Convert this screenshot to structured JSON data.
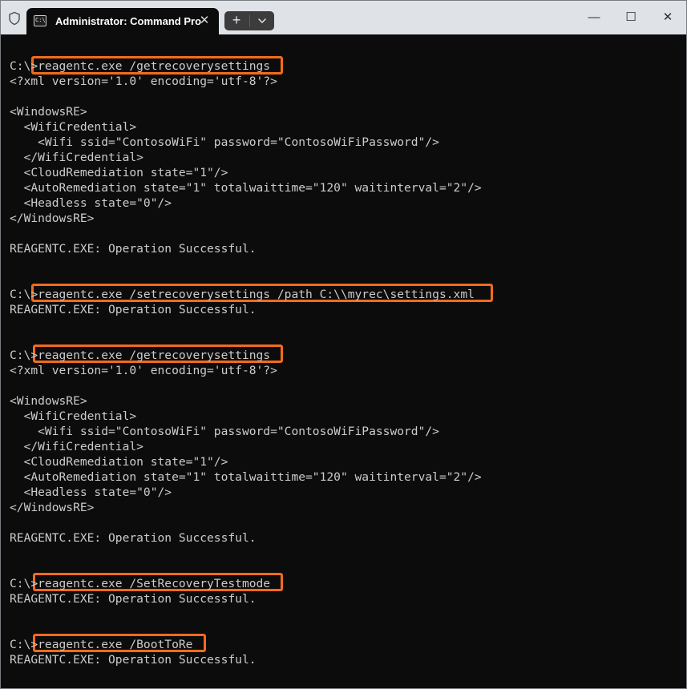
{
  "window": {
    "tab_title": "Administrator: Command Pro",
    "tab_icon_text": "C:\\_",
    "close_tab_glyph": "✕",
    "new_tab_glyph": "+",
    "minimize_glyph": "—",
    "maximize_glyph": "☐",
    "close_glyph": "✕"
  },
  "terminal": {
    "lines": [
      "",
      "C:\\>reagentc.exe /getrecoverysettings",
      "<?xml version='1.0' encoding='utf-8'?>",
      "",
      "<WindowsRE>",
      "  <WifiCredential>",
      "    <Wifi ssid=\"ContosoWiFi\" password=\"ContosoWiFiPassword\"/>",
      "  </WifiCredential>",
      "  <CloudRemediation state=\"1\"/>",
      "  <AutoRemediation state=\"1\" totalwaittime=\"120\" waitinterval=\"2\"/>",
      "  <Headless state=\"0\"/>",
      "</WindowsRE>",
      "",
      "REAGENTC.EXE: Operation Successful.",
      "",
      "",
      "C:\\>reagentc.exe /setrecoverysettings /path C:\\\\myrec\\settings.xml",
      "REAGENTC.EXE: Operation Successful.",
      "",
      "",
      "C:\\>reagentc.exe /getrecoverysettings",
      "<?xml version='1.0' encoding='utf-8'?>",
      "",
      "<WindowsRE>",
      "  <WifiCredential>",
      "    <Wifi ssid=\"ContosoWiFi\" password=\"ContosoWiFiPassword\"/>",
      "  </WifiCredential>",
      "  <CloudRemediation state=\"1\"/>",
      "  <AutoRemediation state=\"1\" totalwaittime=\"120\" waitinterval=\"2\"/>",
      "  <Headless state=\"0\"/>",
      "</WindowsRE>",
      "",
      "REAGENTC.EXE: Operation Successful.",
      "",
      "",
      "C:\\>reagentc.exe /SetRecoveryTestmode",
      "REAGENTC.EXE: Operation Successful.",
      "",
      "",
      "C:\\>reagentc.exe /BootToRe",
      "REAGENTC.EXE: Operation Successful."
    ]
  },
  "colors": {
    "highlight_border": "#f26b1d",
    "terminal_bg": "#0c0c0c",
    "terminal_fg": "#cccccc",
    "titlebar_bg": "#dfe3e8"
  }
}
